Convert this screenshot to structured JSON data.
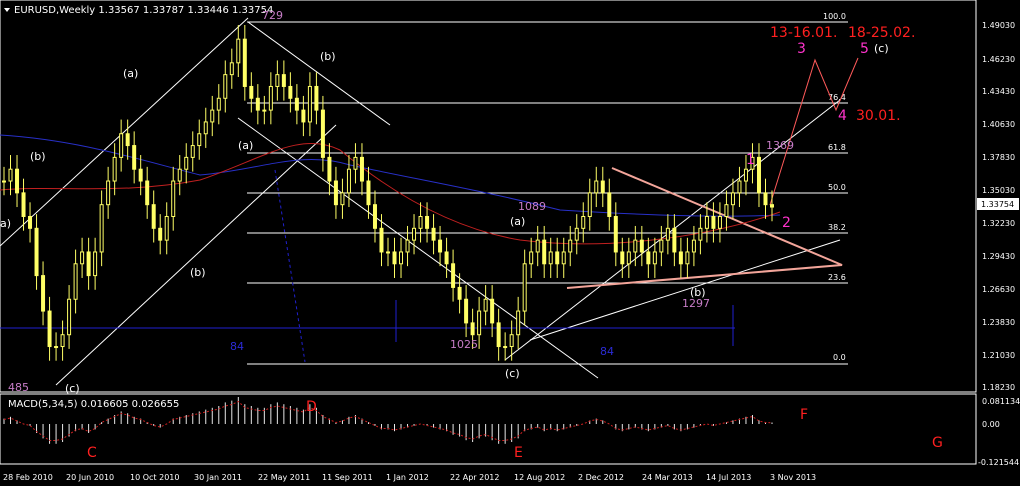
{
  "chart_data": {
    "type": "candlestick",
    "symbol_header": "EURUSD,Weekly  1.33567 1.33787 1.33446 1.33754",
    "macd_header": "MACD(5,34,5) 0.016605 0.026655",
    "current_price_label": "1.33754",
    "y_ticks": [
      "1.49030",
      "1.46230",
      "1.43430",
      "1.40630",
      "1.37830",
      "1.35030",
      "1.32230",
      "1.29430",
      "1.26630",
      "1.23830",
      "1.21030",
      "1.18230"
    ],
    "macd_ticks": [
      "0.081134",
      "0.00",
      "-0.121544"
    ],
    "x_ticks": [
      "28 Feb 2010",
      "20 Jun 2010",
      "10 Oct 2010",
      "30 Jan 2011",
      "22 May 2011",
      "11 Sep 2011",
      "1 Jan 2012",
      "22 Apr 2012",
      "12 Aug 2012",
      "2 Dec 2012",
      "24 Mar 2013",
      "14 Jul 2013",
      "3 Nov 2013"
    ],
    "fib_levels": [
      "100.0",
      "76.4",
      "61.8",
      "50.0",
      "38.2",
      "23.6",
      "0.0"
    ],
    "price_annotations": [
      "729",
      "1369",
      "1089",
      "1025",
      "1297",
      "485",
      "84",
      "84"
    ],
    "wave_labels": [
      "(a)",
      "(b)",
      "(a)",
      "(b)",
      "(a)",
      "(b)",
      "(a)",
      "(b)",
      "(c)",
      "(c)",
      "(b)",
      "a)"
    ],
    "target_labels": [
      "13-16.01.",
      "18-25.02.",
      "30.01."
    ],
    "count_labels": [
      "1",
      "2",
      "3",
      "4",
      "5",
      "(c)"
    ],
    "macd_letters": [
      "C",
      "D",
      "E",
      "F",
      "G"
    ],
    "close_series": [
      1.36,
      1.37,
      1.35,
      1.33,
      1.32,
      1.28,
      1.25,
      1.22,
      1.22,
      1.23,
      1.26,
      1.29,
      1.3,
      1.28,
      1.3,
      1.34,
      1.36,
      1.38,
      1.4,
      1.39,
      1.37,
      1.36,
      1.34,
      1.32,
      1.31,
      1.33,
      1.36,
      1.37,
      1.38,
      1.39,
      1.4,
      1.41,
      1.42,
      1.43,
      1.45,
      1.46,
      1.48,
      1.44,
      1.43,
      1.42,
      1.42,
      1.44,
      1.45,
      1.44,
      1.43,
      1.42,
      1.41,
      1.44,
      1.42,
      1.38,
      1.36,
      1.34,
      1.35,
      1.37,
      1.38,
      1.36,
      1.34,
      1.32,
      1.3,
      1.3,
      1.29,
      1.3,
      1.31,
      1.32,
      1.33,
      1.32,
      1.31,
      1.3,
      1.29,
      1.27,
      1.26,
      1.24,
      1.23,
      1.25,
      1.26,
      1.24,
      1.22,
      1.22,
      1.23,
      1.25,
      1.29,
      1.3,
      1.31,
      1.29,
      1.3,
      1.29,
      1.3,
      1.31,
      1.32,
      1.33,
      1.35,
      1.36,
      1.35,
      1.33,
      1.3,
      1.29,
      1.3,
      1.31,
      1.3,
      1.29,
      1.3,
      1.31,
      1.32,
      1.3,
      1.29,
      1.3,
      1.31,
      1.32,
      1.33,
      1.32,
      1.33,
      1.34,
      1.35,
      1.36,
      1.37,
      1.38,
      1.35,
      1.34,
      1.338
    ]
  }
}
